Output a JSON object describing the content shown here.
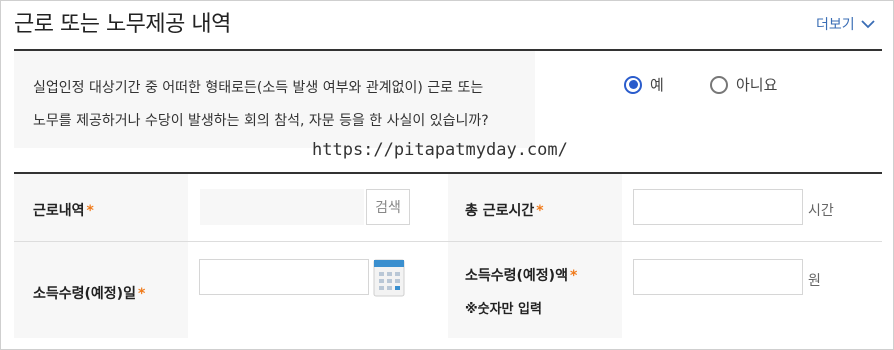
{
  "section": {
    "title": "근로 또는 노무제공 내역",
    "more_label": "더보기"
  },
  "question": {
    "line1": "실업인정 대상기간 중 어떠한 형태로든(소득 발생 여부와 관계없이) 근로 또는",
    "line2": "노무를 제공하거나 수당이 발생하는 회의 참석, 자문 등을 한 사실이 있습니까?",
    "options": [
      {
        "label": "예",
        "selected": true
      },
      {
        "label": "아니요",
        "selected": false
      }
    ]
  },
  "watermark": "https://pitapatmyday.com/",
  "form": {
    "work_history": {
      "label": "근로내역",
      "value": "",
      "search_label": "검색"
    },
    "total_hours": {
      "label": "총 근로시간",
      "value": "",
      "unit": "시간"
    },
    "income_date": {
      "label": "소득수령(예정)일",
      "value": ""
    },
    "income_amount": {
      "label": "소득수령(예정)액",
      "value": "",
      "unit": "원",
      "note": "※숫자만 입력"
    },
    "required_mark": "*"
  },
  "colors": {
    "accent": "#2a5ccc",
    "required": "#f07a1a",
    "link": "#3a6db5"
  }
}
